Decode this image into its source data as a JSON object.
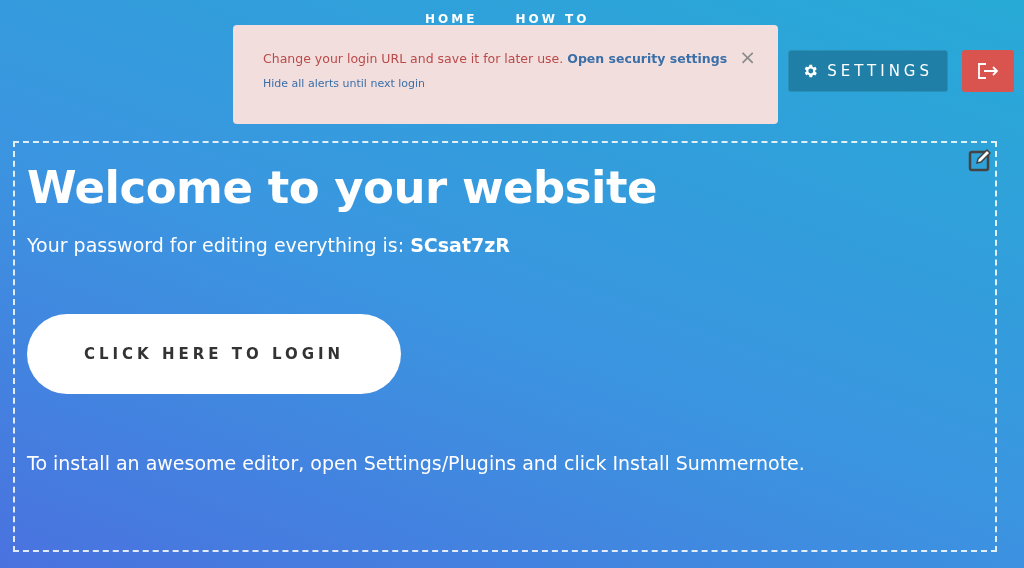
{
  "nav": [
    {
      "label": "HOME"
    },
    {
      "label": "HOW TO"
    }
  ],
  "alert": {
    "message": "Change your login URL and save it for later use.",
    "link": "Open security settings",
    "close": "×",
    "hide_link": "Hide all alerts until next login"
  },
  "settings_button": "SETTINGS",
  "content": {
    "title": "Welcome to your website",
    "password_line": "Your password for editing everything is: **SCsat7zR**",
    "login_button": "CLICK HERE TO LOGIN",
    "hint": "To install an awesome editor, open Settings/Plugins and click Install Summernote."
  }
}
